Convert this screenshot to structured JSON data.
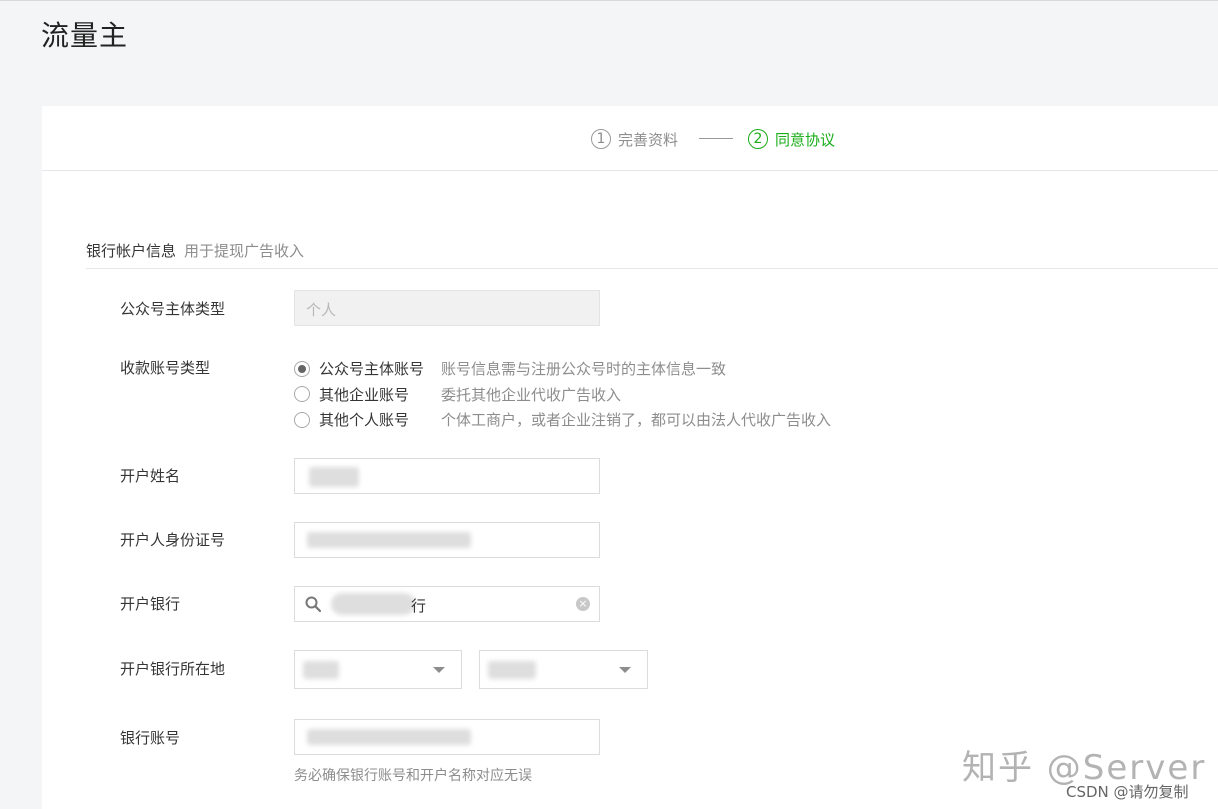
{
  "page": {
    "title": "流量主"
  },
  "steps": [
    {
      "num": "1",
      "label": "完善资料"
    },
    {
      "num": "2",
      "label": "同意协议"
    }
  ],
  "section": {
    "title": "银行帐户信息",
    "desc": "用于提现广告收入"
  },
  "form": {
    "entity_type": {
      "label": "公众号主体类型",
      "value": "个人"
    },
    "account_type": {
      "label": "收款账号类型",
      "options": [
        {
          "label": "公众号主体账号",
          "desc": "账号信息需与注册公众号时的主体信息一致",
          "checked": true
        },
        {
          "label": "其他企业账号",
          "desc": "委托其他企业代收广告收入",
          "checked": false
        },
        {
          "label": "其他个人账号",
          "desc": "个体工商户，或者企业注销了，都可以由法人代收广告收入",
          "checked": false
        }
      ]
    },
    "account_name": {
      "label": "开户姓名"
    },
    "id_number": {
      "label": "开户人身份证号"
    },
    "bank": {
      "label": "开户银行",
      "value_suffix": "行"
    },
    "bank_location": {
      "label": "开户银行所在地"
    },
    "bank_account": {
      "label": "银行账号",
      "hint": "务必确保银行账号和开户名称对应无误"
    }
  },
  "watermark": {
    "main": "知乎 @Server",
    "sub": "CSDN @请勿复制"
  },
  "colors": {
    "accent": "#1aad19",
    "muted": "#8d8d8d",
    "text": "#353535"
  }
}
